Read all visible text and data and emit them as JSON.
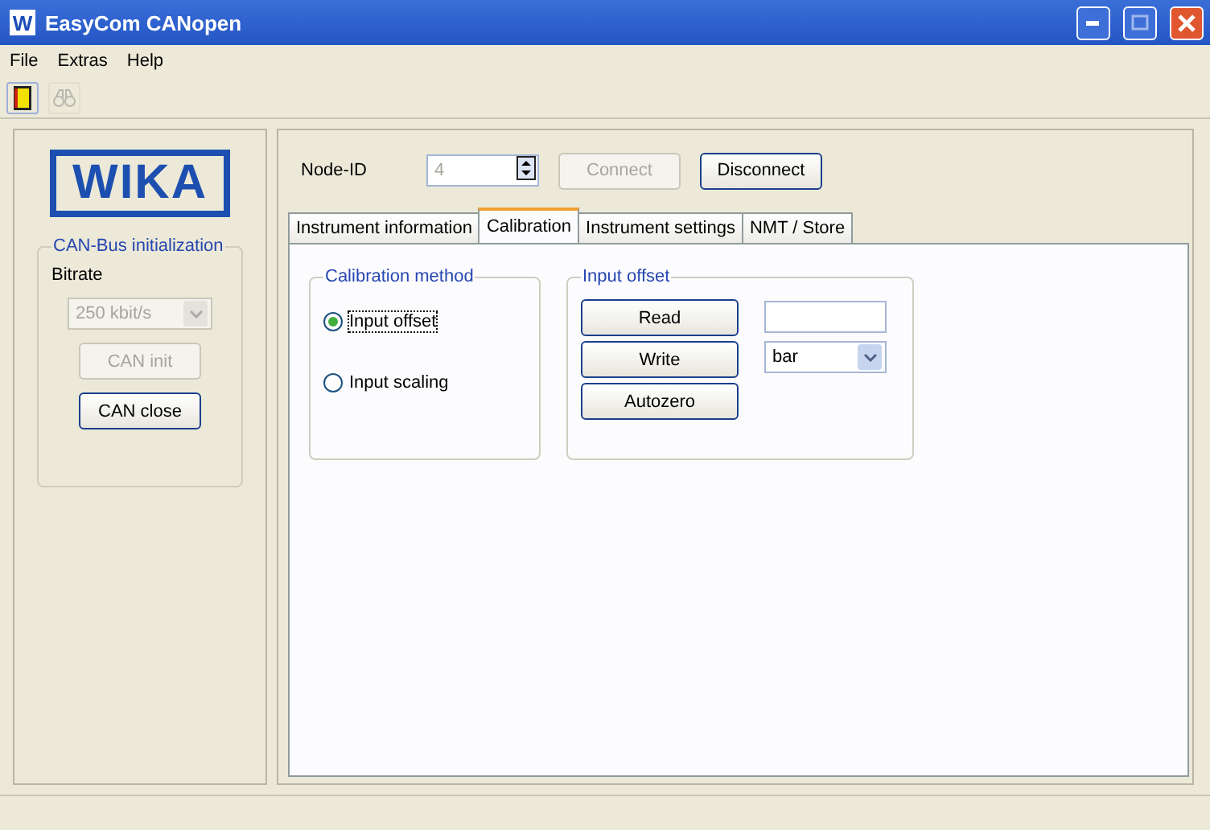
{
  "window": {
    "icon_letter": "W",
    "title": "EasyCom CANopen"
  },
  "menu": [
    {
      "label": "File"
    },
    {
      "label": "Extras"
    },
    {
      "label": "Help"
    }
  ],
  "toolbar": [
    {
      "kind": "exit",
      "disabled": false
    },
    {
      "kind": "binoculars",
      "disabled": true
    }
  ],
  "logo": "WIKA",
  "can_bus": {
    "title": "CAN-Bus initialization",
    "bitrate_label": "Bitrate",
    "bitrate": {
      "value": "250 kbit/s",
      "disabled": true
    },
    "buttons": [
      {
        "label": "CAN init",
        "disabled": true
      },
      {
        "label": "CAN close",
        "disabled": false
      }
    ]
  },
  "node": {
    "label": "Node-ID",
    "value": "4",
    "disabled": true,
    "buttons": [
      {
        "label": "Connect",
        "disabled": true
      },
      {
        "label": "Disconnect",
        "disabled": false
      }
    ]
  },
  "tabs": [
    {
      "label": "Instrument information",
      "selected": false
    },
    {
      "label": "Calibration",
      "selected": true
    },
    {
      "label": "Instrument settings",
      "selected": false
    },
    {
      "label": "NMT / Store",
      "selected": false
    }
  ],
  "calibration_method": {
    "title": "Calibration method",
    "options": [
      {
        "label": "Input offset",
        "selected": true
      },
      {
        "label": "Input scaling",
        "selected": false
      }
    ]
  },
  "input_offset": {
    "title": "Input offset",
    "buttons": [
      {
        "label": "Read"
      },
      {
        "label": "Write"
      },
      {
        "label": "Autozero"
      }
    ],
    "unit": "bar"
  }
}
